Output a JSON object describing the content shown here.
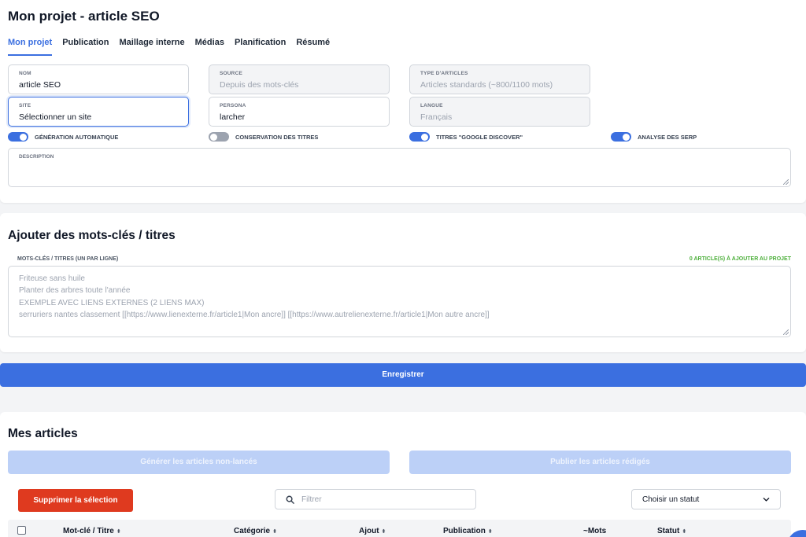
{
  "project": {
    "title": "Mon projet - article SEO",
    "tabs": [
      "Mon projet",
      "Publication",
      "Maillage interne",
      "Médias",
      "Planification",
      "Résumé"
    ],
    "fields": {
      "nom": {
        "label": "NOM",
        "value": "article SEO"
      },
      "source": {
        "label": "SOURCE",
        "value": "Depuis des mots-clés"
      },
      "type": {
        "label": "TYPE D'ARTICLES",
        "value": "Articles standards (~800/1100 mots)"
      },
      "site": {
        "label": "SITE",
        "value": "Sélectionner un site"
      },
      "persona": {
        "label": "PERSONA",
        "value": "larcher"
      },
      "langue": {
        "label": "LANGUE",
        "value": "Français"
      }
    },
    "toggles": [
      {
        "label": "GÉNÉRATION AUTOMATIQUE",
        "on": true
      },
      {
        "label": "CONSERVATION DES TITRES",
        "on": false
      },
      {
        "label": "TITRES \"GOOGLE DISCOVER\"",
        "on": true
      },
      {
        "label": "ANALYSE DES SERP",
        "on": true
      }
    ],
    "description_label": "DESCRIPTION"
  },
  "keywords": {
    "title": "Ajouter des mots-clés / titres",
    "label": "MOTS-CLÉS / TITRES (UN PAR LIGNE)",
    "count_label": "0 ARTICLE(S) À AJOUTER AU PROJET",
    "placeholder_lines": [
      "Friteuse sans huile",
      "Planter des arbres toute l'année",
      "EXEMPLE AVEC LIENS EXTERNES (2 LIENS MAX)",
      "serruriers nantes classement [[https://www.lienexterne.fr/article1|Mon ancre]] [[https://www.autrelienexterne.fr/article1|Mon autre ancre]]"
    ]
  },
  "save_label": "Enregistrer",
  "articles": {
    "title": "Mes articles",
    "generate_label": "Générer les articles non-lancés",
    "publish_label": "Publier les articles rédigés",
    "delete_label": "Supprimer la sélection",
    "filter_placeholder": "Filtrer",
    "status_select": "Choisir un statut",
    "columns": [
      "Mot-clé / Titre",
      "Catégorie",
      "Ajout",
      "Publication",
      "~Mots",
      "Statut"
    ],
    "sort_glyph": "⬍"
  },
  "colors": {
    "accent": "#3b6fe0",
    "danger": "#df3a1f",
    "success": "#4caf3a"
  }
}
